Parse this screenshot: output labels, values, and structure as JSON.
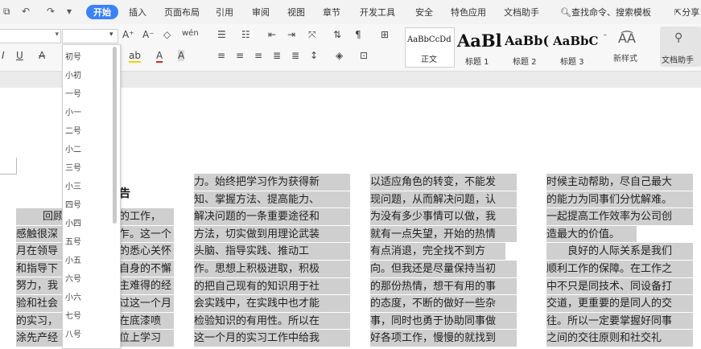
{
  "quick_access": {
    "undo": "↶",
    "redo": "↷",
    "more": "▾",
    "preview": "⧉"
  },
  "menu": {
    "items": [
      "开始",
      "插入",
      "页面布局",
      "引用",
      "审阅",
      "视图",
      "章节",
      "开发工具",
      "安全",
      "特色应用",
      "文档助手"
    ],
    "active_index": 0,
    "search_label": "查找命令、搜索模板",
    "share_label": "分享"
  },
  "ribbon": {
    "font_grow": "A⁺",
    "font_shrink": "A⁻",
    "clear_format": "◇",
    "phonetic": "wén",
    "italic": "I",
    "underline": "U",
    "strike": "A",
    "highlight": "ab",
    "font_color": "A",
    "char_shade": "A",
    "styles": [
      {
        "sample": "AaBbCcDd",
        "label": "正文"
      },
      {
        "sample": "AaBl",
        "label": "标题 1"
      },
      {
        "sample": "AaBb(",
        "label": "标题 2"
      },
      {
        "sample": "AaBbC",
        "label": "标题 3"
      }
    ],
    "new_style_label": "新样式",
    "doc_helper_label": "文档助手"
  },
  "font_size_dropdown": {
    "options": [
      "初号",
      "小初",
      "一号",
      "小一",
      "二号",
      "小二",
      "三号",
      "小三",
      "四号",
      "小四",
      "五号",
      "小五",
      "六号",
      "小六",
      "七号",
      "八号"
    ]
  },
  "document": {
    "title_fragment": "告",
    "column1": {
      "lines": [
        "回顾",
        "感触很深",
        "月在领导",
        "和指导下",
        "努力，我",
        "验和社会",
        "的实习，",
        "涂先产经"
      ],
      "right_lines": [
        "的工作，",
        "乍。这一个",
        "的悉心关怀",
        "自身的不懈",
        "主难得的经",
        "过这一个月",
        "在底漆喷",
        "位上学习"
      ]
    },
    "column2": {
      "lines": [
        "力。始终把学习作为获得新",
        "知、掌握方法、提高能力、",
        "解决问题的一条重要途径和",
        "方法，切实做到用理论武装",
        "头脑、指导实践、推动工",
        "作。思想上积极进取，积极",
        "的把自己现有的知识用于社",
        "会实践中，在实践中也才能",
        "检验知识的有用性。所以在",
        "这一个月的实习工作中给我"
      ]
    },
    "column3": {
      "lines": [
        "以适应角色的转变，不能发",
        "现问题，从而解决问题，认",
        "为没有多少事情可以做，我",
        "就有一点失望，开始的热情",
        "有点消退，完全找不到方",
        "向。但我还是尽量保持当初",
        "的那份热情，想干有用的事",
        "的态度，不断的做好一些杂",
        "事，同时也勇于协助同事做",
        "好各项工作，慢慢的就找到"
      ]
    },
    "column4": {
      "lines": [
        "时候主动帮助，尽自己最大",
        "的能力为同事们分忧解难。",
        "一起提高工作效率为公司创",
        "造最大的价值。",
        "　　良好的人际关系是我们",
        "顺利工作的保障。在工作之",
        "中不只是同技术、同设备打",
        "交道，更重要的是同人的交",
        "往。所以一定要掌握好同事",
        "之间的交往原则和社交礼"
      ]
    }
  },
  "colors": {
    "accent": "#3b82f6",
    "selection": "#cfcfcf"
  }
}
